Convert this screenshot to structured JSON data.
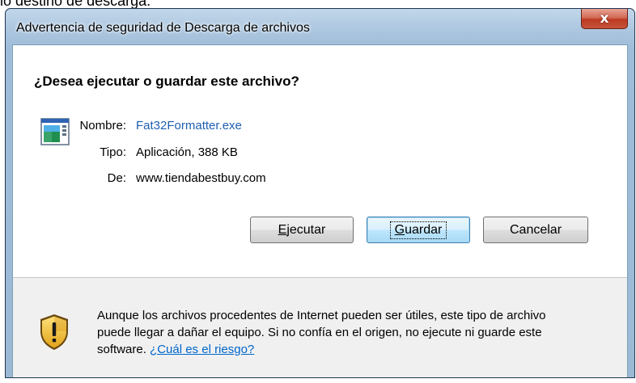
{
  "background": {
    "caption": "lo destino de descarga."
  },
  "window": {
    "title": "Advertencia de seguridad de Descarga de archivos",
    "close_symbol": "x"
  },
  "dialog": {
    "question": "¿Desea ejecutar o guardar este archivo?",
    "file_icon": "executable-file-icon",
    "fields": {
      "name_label": "Nombre:",
      "name_value": "Fat32Formatter.exe",
      "type_label": "Tipo:",
      "type_value": "Aplicación, 388 KB",
      "from_label": "De:",
      "from_value": "www.tiendabestbuy.com"
    },
    "buttons": {
      "run_mnemonic": "E",
      "run_rest": "jecutar",
      "save_mnemonic": "G",
      "save_rest": "uardar",
      "cancel": "Cancelar"
    },
    "warning": {
      "icon": "security-shield-icon",
      "text": "Aunque los archivos procedentes de Internet pueden ser útiles, este tipo de archivo puede llegar a dañar el equipo. Si no confía en el origen, no ejecute ni guarde este software.",
      "link": "¿Cuál es el riesgo?"
    }
  },
  "colors": {
    "link": "#1f5fb2",
    "frame": "#9fbdd9",
    "close_button": "#c6543c",
    "footer": "#f0f0f0"
  }
}
